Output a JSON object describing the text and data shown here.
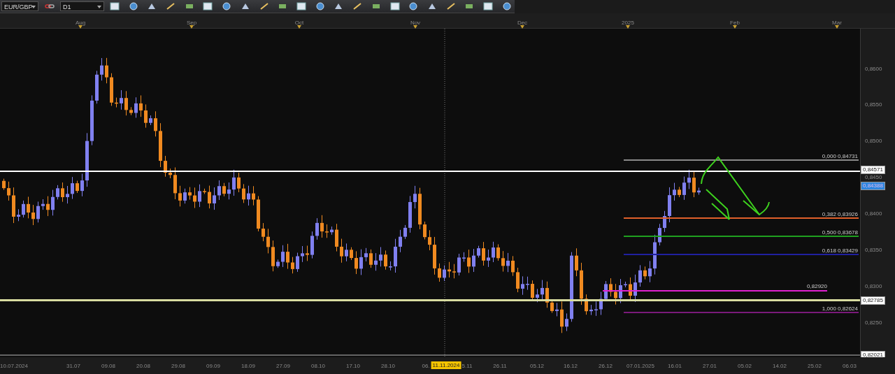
{
  "toolbar": {
    "symbol": "EUR/GBP",
    "timeframe": "D1"
  },
  "time_axis": {
    "months": [
      "Aug",
      "Sep",
      "Oct",
      "Nov",
      "Dec",
      "2025",
      "Feb",
      "Mar"
    ],
    "dates": [
      "10.07.2024",
      "31.07",
      "09.08",
      "20.08",
      "29.08",
      "09.09",
      "18.09",
      "27.09",
      "08.10",
      "17.10",
      "28.10",
      "06.",
      "5.11",
      "26.11",
      "05.12",
      "16.12",
      "26.12",
      "07.01.2025",
      "16.01",
      "27.01",
      "05.02",
      "14.02",
      "25.02",
      "06.03"
    ],
    "crosshair_date": "11.11.2024"
  },
  "price_axis": {
    "ticks": [
      "0,8600",
      "0,8550",
      "0,8500",
      "0,8450",
      "0,8400",
      "0,8350",
      "0,8300",
      "0,8250"
    ],
    "tags": [
      {
        "text": "0,84571",
        "kind": "level"
      },
      {
        "text": "0,84388",
        "kind": "price"
      },
      {
        "text": "0,82785",
        "kind": "level"
      },
      {
        "text": "0,82021",
        "kind": "level"
      }
    ]
  },
  "lines": [
    {
      "color": "#ffffff"
    },
    {
      "color": "#d8dca0"
    },
    {
      "color": "#e020d0",
      "label": "0,82920"
    }
  ],
  "fibonacci": [
    {
      "label": "0,000 0,84731",
      "color": "#8a8a8a"
    },
    {
      "label": "0,382 0,83926",
      "color": "#e0602a"
    },
    {
      "label": "0,500 0,83678",
      "color": "#1fa01f"
    },
    {
      "label": "0,618 0,83429",
      "color": "#2020a0"
    },
    {
      "label": "1,000 0,82624",
      "color": "#7a1a7a"
    }
  ]
}
